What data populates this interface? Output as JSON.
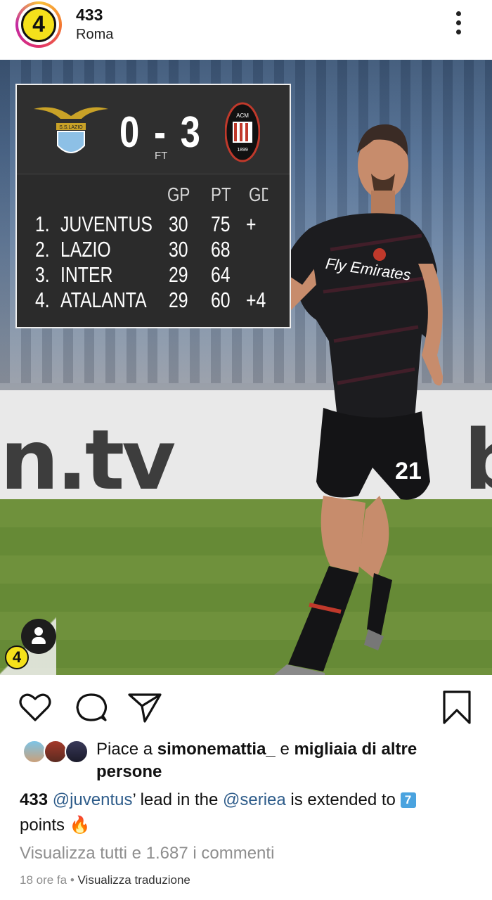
{
  "header": {
    "avatar_text": "4",
    "account_name": "433",
    "location": "Roma"
  },
  "post_image": {
    "scoreboard": {
      "home_team": "S.S.LAZIO",
      "away_team": "ACM 1899",
      "score": "0 - 3",
      "status": "FT",
      "columns": [
        "GP",
        "PT",
        "GD"
      ],
      "rows": [
        {
          "rank": "1.",
          "team": "JUVENTUS",
          "gp": "30",
          "pt": "75",
          "gd": "+"
        },
        {
          "rank": "2.",
          "team": "LAZIO",
          "gp": "30",
          "pt": "68",
          "gd": ""
        },
        {
          "rank": "3.",
          "team": "INTER",
          "gp": "29",
          "pt": "64",
          "gd": ""
        },
        {
          "rank": "4.",
          "team": "ATALANTA",
          "gp": "29",
          "pt": "60",
          "gd": "+4"
        }
      ]
    },
    "board_text": "n.tv",
    "board_text_right": "b",
    "jersey_sponsor": "Fly Emirates",
    "jersey_number": "21",
    "watermark_text": "4"
  },
  "likes": {
    "prefix": "Piace a ",
    "user": "simonemattia_",
    "middle": " e ",
    "others": "migliaia di altre persone"
  },
  "caption": {
    "account": "433",
    "mention1": "@juventus",
    "text1": "’ lead in the ",
    "mention2": "@seriea",
    "text2": " is extended to ",
    "number_emoji": "7",
    "text3": " points ",
    "fire_emoji": "🔥"
  },
  "comments_link": "Visualizza tutti e 1.687 i commenti",
  "meta": {
    "time": "18 ore fa",
    "separator": " • ",
    "translate": "Visualizza traduzione"
  },
  "colors": {
    "mention": "#2e5c8a",
    "muted": "#8e8e8e",
    "logo_yellow": "#f5e11b"
  }
}
